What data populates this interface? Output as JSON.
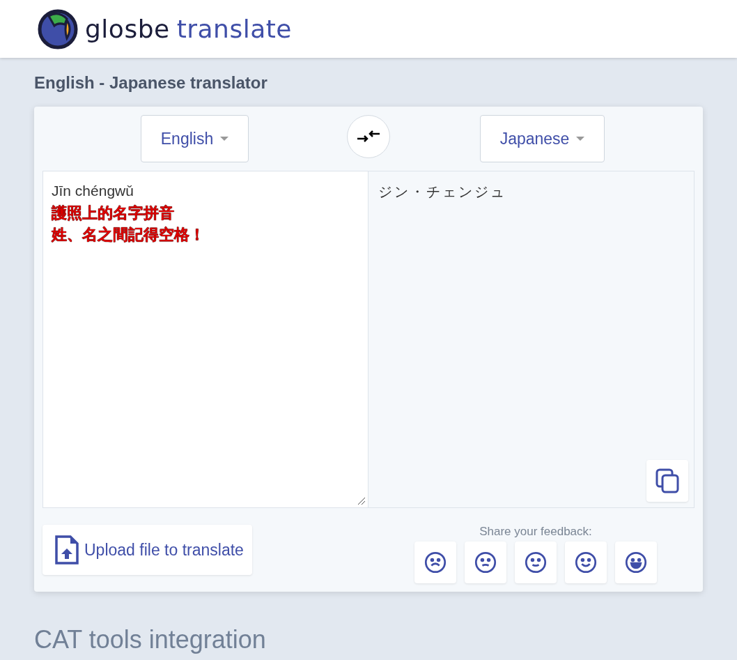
{
  "header": {
    "logo_word": "glosbe",
    "logo_product": "translate"
  },
  "page_title": "English - Japanese translator",
  "source_language": "English",
  "target_language": "Japanese",
  "source_lines": [
    {
      "kind": "plain",
      "text": "Jīn chéngwǔ"
    },
    {
      "kind": "annotation",
      "text": "護照上的名字拼音"
    },
    {
      "kind": "annotation",
      "text": "姓、名之間記得空格！"
    }
  ],
  "translation": "ジン・チェンジュ",
  "upload_button": "Upload file to translate",
  "feedback": {
    "label": "Share your feedback:",
    "faces": [
      {
        "kind": "sad"
      },
      {
        "kind": "unsure"
      },
      {
        "kind": "neutral"
      },
      {
        "kind": "smile"
      },
      {
        "kind": "grin"
      }
    ]
  },
  "section_heading": "CAT tools integration"
}
